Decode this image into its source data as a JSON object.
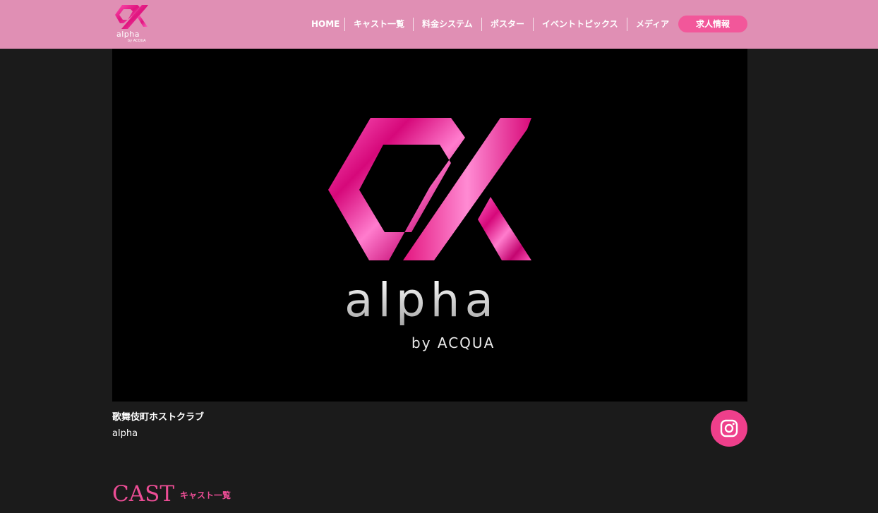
{
  "header": {
    "logo_text": "alpha",
    "logo_sub": "by ACQUA",
    "nav": [
      {
        "label": "HOME"
      },
      {
        "label": "キャスト一覧"
      },
      {
        "label": "料金システム"
      },
      {
        "label": "ポスター"
      },
      {
        "label": "イベントトピックス"
      },
      {
        "label": "メディア"
      }
    ],
    "recruit_label": "求人情報"
  },
  "hero": {
    "word": "alpha",
    "sub": "by ACQUA"
  },
  "info": {
    "line1": "歌舞伎町ホストクラブ",
    "line2": "alpha"
  },
  "cast_section": {
    "title": "CAST",
    "subtitle": "キャスト一覧"
  },
  "colors": {
    "header_bg": "#e08fb4",
    "accent": "#ec4d95",
    "button": "#f2579a",
    "page_bg": "#1b1b1b"
  },
  "icons": {
    "social": "instagram-icon"
  }
}
